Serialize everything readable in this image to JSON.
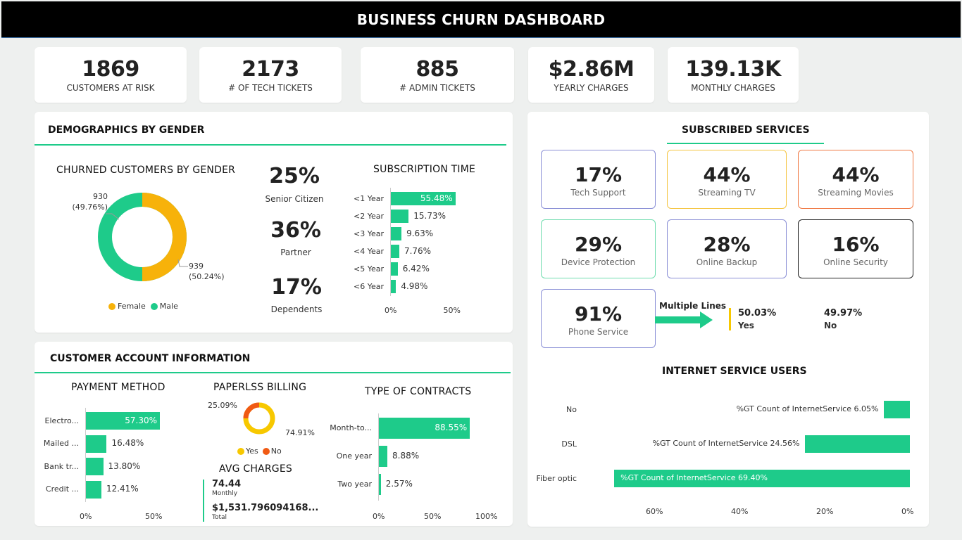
{
  "header": {
    "title": "BUSINESS CHURN DASHBOARD"
  },
  "kpis": [
    {
      "value": "1869",
      "label": "CUSTOMERS AT RISK"
    },
    {
      "value": "2173",
      "label": "# OF TECH TICKETS"
    },
    {
      "value": "885",
      "label": "# ADMIN TICKETS"
    },
    {
      "value": "$2.86M",
      "label": "YEARLY CHARGES"
    },
    {
      "value": "139.13K",
      "label": "MONTHLY CHARGES"
    }
  ],
  "demographics": {
    "title": "DEMOGRAPHICS BY GENDER",
    "donut_title": "CHURNED CUSTOMERS BY GENDER",
    "male_label": "930",
    "male_pct": "(49.76%)",
    "female_label": "939",
    "female_pct": "(50.24%)",
    "legend": [
      "Female",
      "Male"
    ],
    "stats": [
      {
        "value": "25%",
        "label": "Senior Citizen"
      },
      {
        "value": "36%",
        "label": "Partner"
      },
      {
        "value": "17%",
        "label": "Dependents"
      }
    ],
    "sub_title": "SUBSCRIPTION TIME"
  },
  "account": {
    "title": "CUSTOMER ACCOUNT INFORMATION",
    "payment_title": "PAYMENT METHOD",
    "paperless_title": "PAPERLSS BILLING",
    "paperless_no": "25.09%",
    "paperless_yes": "74.91%",
    "paperless_legend": [
      "Yes",
      "No"
    ],
    "avg_title": "AVG CHARGES",
    "avg_monthly_value": "74.44",
    "avg_monthly_label": "Monthly",
    "avg_total_value": "$1,531.796094168...",
    "avg_total_label": "Total",
    "contracts_title": "TYPE OF CONTRACTS"
  },
  "services": {
    "title": "SUBSCRIBED SERVICES",
    "items": [
      {
        "value": "17%",
        "label": "Tech Support",
        "color": "#8a8fd6"
      },
      {
        "value": "44%",
        "label": "Streaming TV",
        "color": "#f5c542"
      },
      {
        "value": "44%",
        "label": "Streaming Movies",
        "color": "#f07a45"
      },
      {
        "value": "29%",
        "label": "Device Protection",
        "color": "#6fdcae"
      },
      {
        "value": "28%",
        "label": "Online Backup",
        "color": "#8a8fd6"
      },
      {
        "value": "16%",
        "label": "Online Security",
        "color": "#222222"
      },
      {
        "value": "91%",
        "label": "Phone Service",
        "color": "#8a8fd6"
      }
    ],
    "multiple_lines_label": "Multiple Lines",
    "ml_yes_value": "50.03%",
    "ml_yes_label": "Yes",
    "ml_no_value": "49.97%",
    "ml_no_label": "No",
    "internet_title": "INTERNET SERVICE USERS"
  },
  "chart_data": [
    {
      "type": "pie",
      "title": "CHURNED CUSTOMERS BY GENDER",
      "categories": [
        "Female",
        "Male"
      ],
      "values": [
        939,
        930
      ],
      "percent": [
        50.24,
        49.76
      ],
      "colors": [
        "#f7b20a",
        "#1ecb8a"
      ]
    },
    {
      "type": "bar",
      "title": "SUBSCRIPTION TIME",
      "categories": [
        "<1 Year",
        "<2 Year",
        "<3 Year",
        "<4 Year",
        "<5 Year",
        "<6 Year"
      ],
      "values": [
        55.48,
        15.73,
        9.63,
        7.76,
        6.42,
        4.98
      ],
      "value_labels": [
        "55.48%",
        "15.73%",
        "9.63%",
        "7.76%",
        "6.42%",
        "4.98%"
      ],
      "xlim": [
        0,
        50
      ],
      "ticks": [
        "0%",
        "50%"
      ]
    },
    {
      "type": "bar",
      "title": "PAYMENT METHOD",
      "categories": [
        "Electro...",
        "Mailed ...",
        "Bank tr...",
        "Credit ..."
      ],
      "values": [
        57.3,
        16.48,
        13.8,
        12.41
      ],
      "value_labels": [
        "57.30%",
        "16.48%",
        "13.80%",
        "12.41%"
      ],
      "xlim": [
        0,
        50
      ],
      "ticks": [
        "0%",
        "50%"
      ]
    },
    {
      "type": "pie",
      "title": "PAPERLSS BILLING",
      "categories": [
        "Yes",
        "No"
      ],
      "values": [
        74.91,
        25.09
      ],
      "colors": [
        "#f7c800",
        "#f05a14"
      ]
    },
    {
      "type": "bar",
      "title": "TYPE OF CONTRACTS",
      "categories": [
        "Month-to...",
        "One year",
        "Two year"
      ],
      "values": [
        88.55,
        8.88,
        2.57
      ],
      "value_labels": [
        "88.55%",
        "8.88%",
        "2.57%"
      ],
      "xlim": [
        0,
        100
      ],
      "ticks": [
        "0%",
        "50%",
        "100%"
      ]
    },
    {
      "type": "bar",
      "title": "INTERNET SERVICE USERS",
      "categories": [
        "No",
        "DSL",
        "Fiber optic"
      ],
      "values": [
        6.05,
        24.56,
        69.4
      ],
      "value_labels": [
        "%GT Count of InternetService 6.05%",
        "%GT Count of InternetService 24.56%",
        "%GT Count of InternetService 69.40%"
      ],
      "ticks": [
        "60%",
        "40%",
        "20%",
        "0%"
      ],
      "reversed": true
    }
  ]
}
